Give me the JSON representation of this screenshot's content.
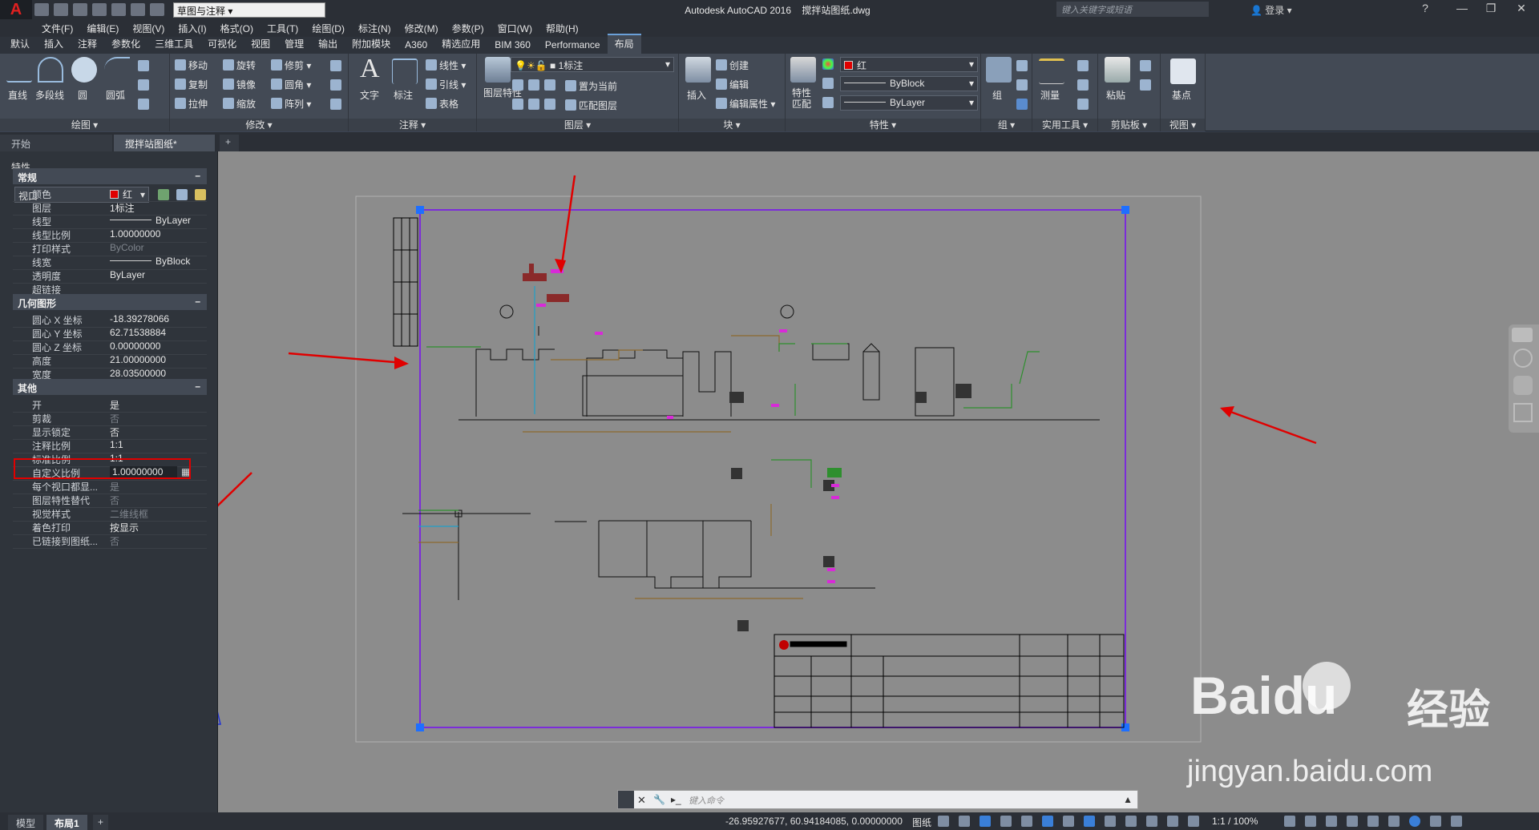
{
  "app": {
    "title": "Autodesk AutoCAD 2016",
    "filename": "搅拌站图纸.dwg",
    "workspace": "草图与注释",
    "search_placeholder": "键入关键字或短语",
    "login": "登录"
  },
  "menu": [
    "文件(F)",
    "编辑(E)",
    "视图(V)",
    "插入(I)",
    "格式(O)",
    "工具(T)",
    "绘图(D)",
    "标注(N)",
    "修改(M)",
    "参数(P)",
    "窗口(W)",
    "帮助(H)"
  ],
  "ribbon_tabs": [
    "默认",
    "插入",
    "注释",
    "参数化",
    "三维工具",
    "可视化",
    "视图",
    "管理",
    "输出",
    "附加模块",
    "A360",
    "精选应用",
    "BIM 360",
    "Performance",
    "布局"
  ],
  "ribbon_active_tab": "布局",
  "ribbon": {
    "draw": {
      "title": "绘图",
      "line": "直线",
      "polyline": "多段线",
      "circle": "圆",
      "arc": "圆弧"
    },
    "modify": {
      "title": "修改",
      "move": "移动",
      "rotate": "旋转",
      "trim": "修剪",
      "copy": "复制",
      "mirror": "镜像",
      "fillet": "圆角",
      "stretch": "拉伸",
      "scale": "缩放",
      "array": "阵列"
    },
    "annotation": {
      "title": "注释",
      "text": "文字",
      "dimension": "标注",
      "linear": "线性",
      "leader": "引线",
      "table": "表格"
    },
    "layers": {
      "title": "图层",
      "layer_props": "图层特性",
      "current_layer": "1标注",
      "make_current": "置为当前",
      "match_layer": "匹配图层"
    },
    "block": {
      "title": "块",
      "insert": "插入",
      "create": "创建",
      "edit": "编辑",
      "edit_attr": "编辑属性"
    },
    "properties": {
      "title": "特性",
      "match": "特性匹配",
      "color": "红",
      "linetype": "ByBlock",
      "lineweight": "ByLayer"
    },
    "groups": {
      "title": "组",
      "group": "组"
    },
    "utilities": {
      "title": "实用工具",
      "measure": "测量"
    },
    "clipboard": {
      "title": "剪贴板",
      "paste": "粘贴"
    },
    "view": {
      "title": "视图",
      "base": "基点"
    }
  },
  "doc_tabs": [
    "开始",
    "搅拌站图纸*"
  ],
  "palette": {
    "title": "特性",
    "object_type": "视口",
    "sections": {
      "general": {
        "title": "常规",
        "rows": [
          {
            "name": "颜色",
            "value": "红",
            "swatch": "#e00000"
          },
          {
            "name": "图层",
            "value": "1标注"
          },
          {
            "name": "线型",
            "value": "ByLayer",
            "line": true
          },
          {
            "name": "线型比例",
            "value": "1.00000000"
          },
          {
            "name": "打印样式",
            "value": "ByColor",
            "dim": true
          },
          {
            "name": "线宽",
            "value": "ByBlock",
            "line": true
          },
          {
            "name": "透明度",
            "value": "ByLayer"
          },
          {
            "name": "超链接",
            "value": ""
          }
        ]
      },
      "geometry": {
        "title": "几何图形",
        "rows": [
          {
            "name": "圆心 X 坐标",
            "value": "-18.39278066"
          },
          {
            "name": "圆心 Y 坐标",
            "value": "62.71538884"
          },
          {
            "name": "圆心 Z 坐标",
            "value": "0.00000000"
          },
          {
            "name": "高度",
            "value": "21.00000000"
          },
          {
            "name": "宽度",
            "value": "28.03500000"
          }
        ]
      },
      "misc": {
        "title": "其他",
        "rows": [
          {
            "name": "开",
            "value": "是"
          },
          {
            "name": "剪裁",
            "value": "否",
            "dim": true
          },
          {
            "name": "显示锁定",
            "value": "否"
          },
          {
            "name": "注释比例",
            "value": "1:1"
          },
          {
            "name": "标准比例",
            "value": "1:1"
          },
          {
            "name": "自定义比例",
            "value": "1.00000000",
            "highlight": true
          },
          {
            "name": "每个视口都显...",
            "value": "是",
            "dim": true
          },
          {
            "name": "图层特性替代",
            "value": "否",
            "dim": true
          },
          {
            "name": "视觉样式",
            "value": "二维线框",
            "dim": true
          },
          {
            "name": "着色打印",
            "value": "按显示"
          },
          {
            "name": "已链接到图纸...",
            "value": "否",
            "dim": true
          }
        ]
      }
    }
  },
  "layout_tabs": [
    "模型",
    "布局1"
  ],
  "status": {
    "coords": "-26.95927677, 60.94184085, 0.00000000",
    "space": "图纸",
    "scale": "1:1 / 100%"
  },
  "command": {
    "placeholder": "键入命令"
  },
  "colors": {
    "viewport_border": "#7b2cd9",
    "grip": "#1e6fff",
    "arrow": "#e00000",
    "highlight_box": "#e00000"
  },
  "watermark": {
    "brand": "Baidu",
    "product": "经验",
    "url": "jingyan.baidu.com"
  }
}
